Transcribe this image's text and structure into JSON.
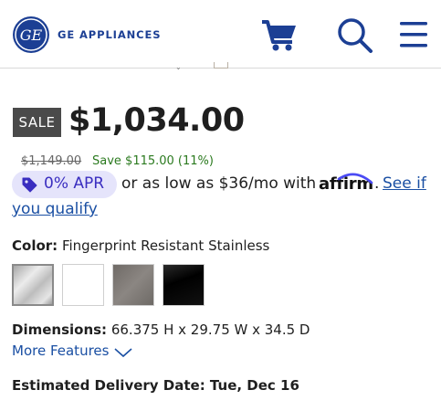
{
  "header": {
    "brand": "GE APPLIANCES",
    "logo_monogram": "GE",
    "icons": [
      "cart-icon",
      "search-icon",
      "menu-icon"
    ]
  },
  "pricing": {
    "badge": "SALE",
    "price": "$1,034.00",
    "original_price": "$1,149.00",
    "savings": "Save $115.00 (11%)"
  },
  "financing": {
    "apr_label": "0% APR",
    "text": "or as low as $36/mo with",
    "provider": "affirm",
    "link_part1": "See if",
    "link_part2": "you qualify"
  },
  "color": {
    "label": "Color:",
    "value": "Fingerprint Resistant Stainless",
    "swatches": [
      "Fingerprint Resistant Stainless",
      "White",
      "Slate",
      "Black"
    ]
  },
  "dimensions": {
    "label": "Dimensions:",
    "value": "66.375 H x 29.75 W x 34.5 D"
  },
  "more_features": "More Features",
  "delivery": "Estimated Delivery Date: Tue, Dec 16",
  "colors": {
    "brand_blue": "#1c3f94",
    "link_blue": "#1a4fa3",
    "save_green": "#2b7a1f",
    "apr_purple": "#3a2ec0",
    "sale_badge": "#4a4a4a"
  }
}
